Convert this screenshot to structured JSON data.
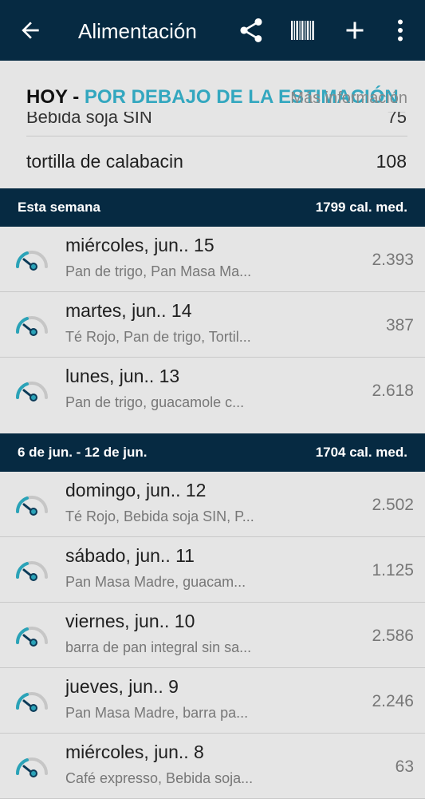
{
  "appbar": {
    "title": "Alimentación",
    "icons": [
      "back-arrow-icon",
      "share-icon",
      "barcode-icon",
      "plus-icon",
      "more-vert-icon"
    ]
  },
  "today": {
    "label": "HOY",
    "separator": " - ",
    "status": "POR DEBAJO DE LA ESTIMACIÓN",
    "more": "Más información",
    "partial_item": "Bebida soja SIN",
    "partial_value": "75",
    "item": {
      "name": "tortilla de calabacin",
      "value": "108"
    }
  },
  "sections": [
    {
      "title": "Esta semana",
      "avg": "1799 cal. med.",
      "days": [
        {
          "name": "miércoles, jun.. 15",
          "foods": "Pan de trigo, Pan Masa Ma...",
          "value": "2.393"
        },
        {
          "name": "martes, jun.. 14",
          "foods": "Té Rojo, Pan de trigo, Tortil...",
          "value": "387"
        },
        {
          "name": "lunes, jun.. 13",
          "foods": "Pan de trigo, guacamole c...",
          "value": "2.618"
        }
      ]
    },
    {
      "title": "6 de jun. - 12 de jun.",
      "avg": "1704 cal. med.",
      "days": [
        {
          "name": "domingo, jun.. 12",
          "foods": "Té Rojo, Bebida soja SIN, P...",
          "value": "2.502"
        },
        {
          "name": "sábado, jun.. 11",
          "foods": "Pan Masa Madre, guacam...",
          "value": "1.125"
        },
        {
          "name": "viernes, jun.. 10",
          "foods": "barra de pan integral sin sa...",
          "value": "2.586"
        },
        {
          "name": "jueves, jun.. 9",
          "foods": "Pan Masa Madre, barra pa...",
          "value": "2.246"
        },
        {
          "name": "miércoles, jun.. 8",
          "foods": "Café expresso, Bebida soja...",
          "value": "63"
        }
      ]
    }
  ],
  "colors": {
    "appbar": "#062a42",
    "accent": "#33a7bf",
    "gauge_teal": "#2aa3b8",
    "gauge_navy": "#0b3a57"
  }
}
